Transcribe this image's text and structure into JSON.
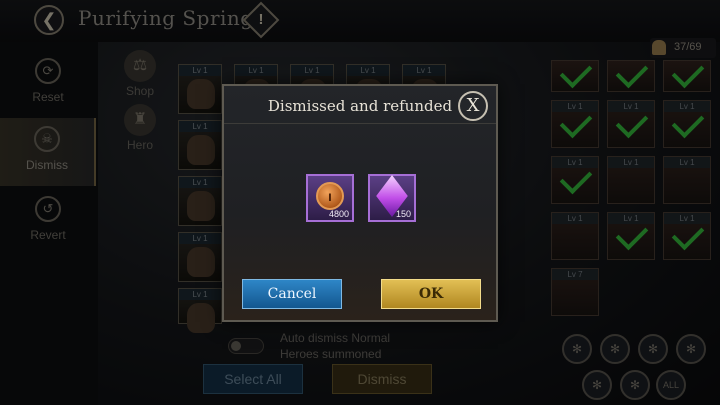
{
  "header": {
    "title": "Purifying Spring",
    "back_icon": "back-arrow-icon",
    "info_icon": "exclamation-icon"
  },
  "hero_count": {
    "text": "37/69",
    "icon": "helmet-icon"
  },
  "left_nav": [
    {
      "label": "Reset",
      "icon": "reset-icon"
    },
    {
      "label": "Dismiss",
      "icon": "skull-icon"
    },
    {
      "label": "Revert",
      "icon": "revert-icon"
    }
  ],
  "side_buttons": [
    {
      "label": "Shop",
      "icon": "scales-icon"
    },
    {
      "label": "Hero",
      "icon": "helmet-icon"
    }
  ],
  "hero_level_label": "Lv 1",
  "right_grid_levels": [
    "Lv 1",
    "Lv 1",
    "Lv 1",
    "Lv 1",
    "Lv 1",
    "Lv 1",
    "Lv 1",
    "Lv 1",
    "Lv 1",
    "Lv 1",
    "Lv 1",
    "Lv 1",
    "Lv 7"
  ],
  "filters": {
    "all_label": "ALL"
  },
  "bottom": {
    "auto_dismiss_text": "Auto dismiss Normal Heroes summoned",
    "select_all": "Select All",
    "dismiss": "Dismiss"
  },
  "dialog": {
    "title": "Dismissed and refunded",
    "close": "X",
    "rewards": [
      {
        "icon": "gold-coin-icon",
        "amount": "4800"
      },
      {
        "icon": "purple-crystal-icon",
        "amount": "150"
      }
    ],
    "cancel": "Cancel",
    "ok": "OK"
  },
  "colors": {
    "cancel_button": "#1f6fb0",
    "ok_button": "#c9a33a",
    "check": "#38c23f",
    "reward_border": "#a66fd6"
  }
}
